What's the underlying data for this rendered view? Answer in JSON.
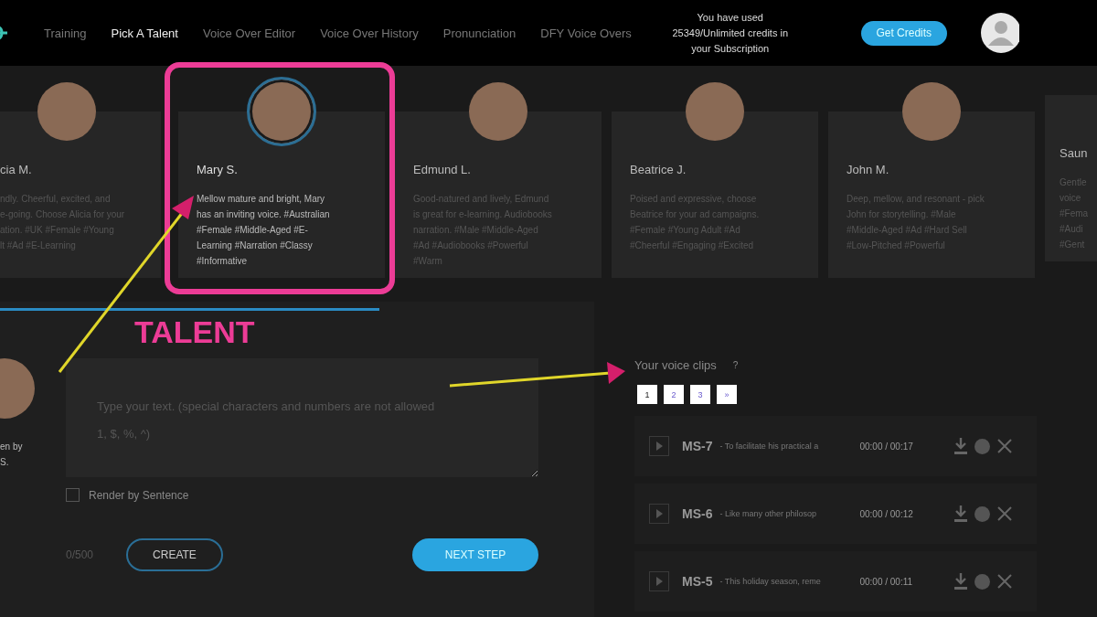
{
  "nav": {
    "items": [
      {
        "label": "Training",
        "selected": false
      },
      {
        "label": "Pick A Talent",
        "selected": true
      },
      {
        "label": "Voice Over Editor",
        "selected": false
      },
      {
        "label": "Voice Over History",
        "selected": false
      },
      {
        "label": "Pronunciation",
        "selected": false
      },
      {
        "label": "DFY Voice Overs",
        "selected": false
      }
    ],
    "credits_lines": [
      "You have used",
      "25349/Unlimited credits in",
      "your Subscription"
    ],
    "get_credits": "Get Credits"
  },
  "talents": [
    {
      "name": "cia M.",
      "selected": false,
      "lines": [
        "ndly. Cheerful, excited, and",
        "e-going. Choose Alicia for your",
        "ation. #UK #Female #Young",
        "lt #Ad #E-Learning"
      ]
    },
    {
      "name": "Mary S.",
      "selected": true,
      "lines": [
        "Mellow mature and bright, Mary",
        "has an inviting voice. #Australian",
        "#Female #Middle-Aged #E-",
        "Learning #Narration #Classy",
        "#Informative"
      ]
    },
    {
      "name": "Edmund L.",
      "selected": false,
      "lines": [
        "Good-natured and lively, Edmund",
        "is great for e-learning. Audiobooks",
        "narration. #Male #Middle-Aged",
        "#Ad #Audiobooks #Powerful",
        "#Warm"
      ]
    },
    {
      "name": "Beatrice J.",
      "selected": false,
      "lines": [
        "Poised and expressive, choose",
        "Beatrice for your ad campaigns.",
        "#Female #Young Adult #Ad",
        "#Cheerful #Engaging #Excited"
      ]
    },
    {
      "name": "John M.",
      "selected": false,
      "lines": [
        "Deep, mellow, and resonant - pick",
        "John for storytelling. #Male",
        "#Middle-Aged #Ad #Hard Sell",
        "#Low-Pitched #Powerful"
      ]
    },
    {
      "name": "Saun",
      "selected": false,
      "lines": [
        "Gentle",
        "voice",
        "#Fema",
        "#Audi",
        "#Gent"
      ]
    }
  ],
  "editor": {
    "written_by_lines": [
      "en by",
      "S."
    ],
    "placeholder": "Type your text. (special characters and numbers are not allowed\n1, $, %, ^)",
    "render_by_sentence": {
      "label": "Render by Sentence",
      "checked": false
    },
    "counter": "0/500",
    "create": "CREATE",
    "next_step": "NEXT STEP"
  },
  "clips": {
    "title": "Your voice clips",
    "help": "?",
    "pages": [
      {
        "label": "1",
        "selected": true
      },
      {
        "label": "2",
        "selected": false
      },
      {
        "label": "3",
        "selected": false
      },
      {
        "label": "»",
        "selected": false
      }
    ],
    "items": [
      {
        "name": "MS-7",
        "snippet": "- To facilitate his practical a",
        "time": "00:00 / 00:17"
      },
      {
        "name": "MS-6",
        "snippet": "- Like many other philosop",
        "time": "00:00 / 00:12"
      },
      {
        "name": "MS-5",
        "snippet": "- This holiday season, reme",
        "time": "00:00 / 00:11"
      }
    ]
  },
  "annotation": {
    "label": "TALENT"
  }
}
